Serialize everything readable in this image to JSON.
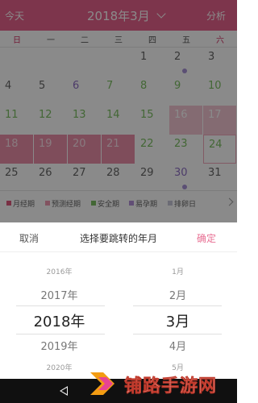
{
  "header": {
    "today": "今天",
    "month": "2018年3月",
    "analyze": "分析",
    "bg_color": "#e8638c"
  },
  "weekdays": [
    "日",
    "一",
    "二",
    "三",
    "四",
    "五",
    "六"
  ],
  "calendar": {
    "rows": [
      [
        {
          "n": ""
        },
        {
          "n": ""
        },
        {
          "n": ""
        },
        {
          "n": ""
        },
        {
          "n": "1"
        },
        {
          "n": "2",
          "dot": true
        },
        {
          "n": "3"
        }
      ],
      [
        {
          "n": "4"
        },
        {
          "n": "5"
        },
        {
          "n": "6",
          "c": "purple"
        },
        {
          "n": "7",
          "c": "green"
        },
        {
          "n": "8",
          "c": "green"
        },
        {
          "n": "9",
          "c": "green"
        },
        {
          "n": "10",
          "c": "green"
        }
      ],
      [
        {
          "n": "11",
          "c": "green"
        },
        {
          "n": "12",
          "c": "green"
        },
        {
          "n": "13",
          "c": "green"
        },
        {
          "n": "14",
          "c": "green"
        },
        {
          "n": "15",
          "c": "green"
        },
        {
          "n": "16",
          "c": "predict"
        },
        {
          "n": "17",
          "c": "predict"
        }
      ],
      [
        {
          "n": "18",
          "c": "period"
        },
        {
          "n": "19",
          "c": "period"
        },
        {
          "n": "20",
          "c": "period"
        },
        {
          "n": "21",
          "c": "period"
        },
        {
          "n": "22",
          "c": "green"
        },
        {
          "n": "23",
          "c": "green"
        },
        {
          "n": "24",
          "c": "green",
          "today": true
        }
      ],
      [
        {
          "n": "25"
        },
        {
          "n": "26"
        },
        {
          "n": "27"
        },
        {
          "n": "28"
        },
        {
          "n": "29"
        },
        {
          "n": "30",
          "c": "purple",
          "dot": true
        },
        {
          "n": "31"
        }
      ]
    ]
  },
  "legend": [
    {
      "label": "月经期",
      "color": "#e05a7f"
    },
    {
      "label": "预测经期",
      "color": "#f09ab2"
    },
    {
      "label": "安全期",
      "color": "#7cbf63"
    },
    {
      "label": "易孕期",
      "color": "#b391d8"
    },
    {
      "label": "排卵日",
      "color": "#c8c8d8"
    }
  ],
  "sheet": {
    "cancel": "取消",
    "title": "选择要跳转的年月",
    "confirm": "确定",
    "years": [
      "2016年",
      "2017年",
      "2018年",
      "2019年",
      "2020年"
    ],
    "months": [
      "1月",
      "2月",
      "3月",
      "4月",
      "5月"
    ],
    "selected_year": "2018年",
    "selected_month": "3月"
  },
  "watermark": {
    "text": "铺路手游网"
  }
}
